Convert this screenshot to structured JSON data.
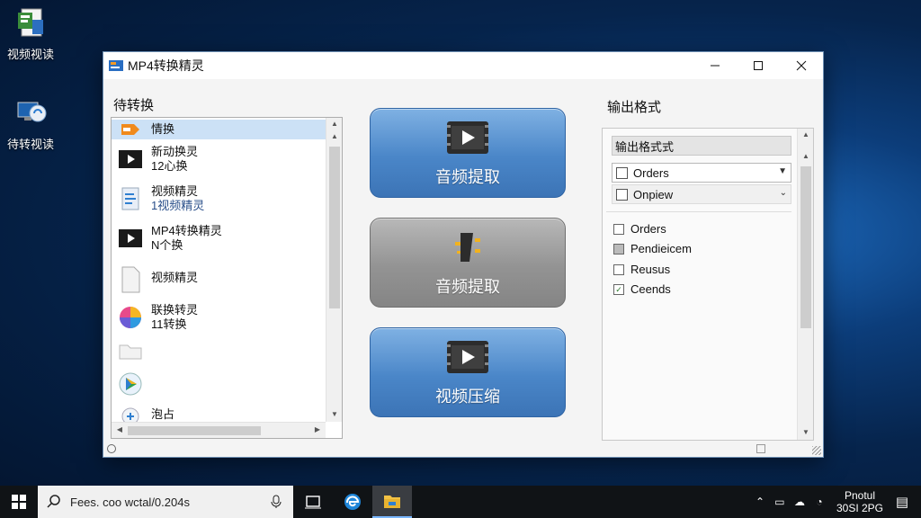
{
  "desktop": {
    "icons": [
      {
        "label": "视频视读"
      },
      {
        "label": "待转视读"
      }
    ]
  },
  "window": {
    "title": "MP4转换精灵",
    "pending_label": "待转换",
    "output_label": "输出格式",
    "files": [
      {
        "line1": "情换",
        "line2": ""
      },
      {
        "line1": "新动换灵",
        "line2": "12心换"
      },
      {
        "line1": "视频精灵",
        "line2": "1视频精灵"
      },
      {
        "line1": "MP4转换精灵",
        "line2": "N个换"
      },
      {
        "line1": "视频精灵",
        "line2": ""
      },
      {
        "line1": "联换转灵",
        "line2": "11转换"
      },
      {
        "line1": "",
        "line2": ""
      },
      {
        "line1": "",
        "line2": ""
      },
      {
        "line1": "泡占",
        "line2": ""
      }
    ],
    "buttons": [
      {
        "label": "音频提取",
        "style": "blue"
      },
      {
        "label": "音频提取",
        "style": "gray"
      },
      {
        "label": "视频压缩",
        "style": "blue"
      }
    ],
    "format_combo": "输出格式式",
    "combo_a": "Orders",
    "combo_b": "Onpiew",
    "options": [
      {
        "label": "Orders",
        "checked": false
      },
      {
        "label": "Pendieicem",
        "checked": false
      },
      {
        "label": "Reusus",
        "checked": false
      },
      {
        "label": "Ceends",
        "checked": true
      }
    ]
  },
  "taskbar": {
    "search_text": "Fees. coo wctal/0.204s",
    "clock_line1": "Pnotul",
    "clock_line2": "30SI 2PG"
  },
  "colors": {
    "button_blue": "#4a86c8",
    "button_gray": "#939393",
    "selection": "#cce1f6"
  }
}
